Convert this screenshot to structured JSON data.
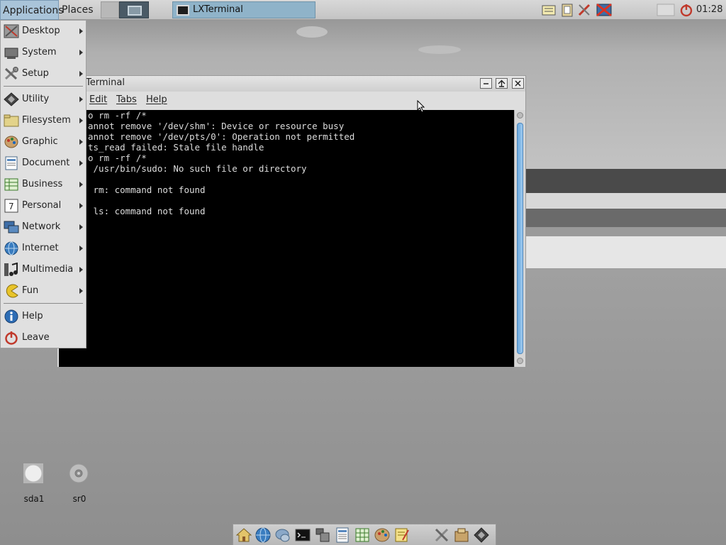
{
  "top_panel": {
    "applications_label": "Applications",
    "places_label": "Places",
    "taskbar_window_label": "LXTerminal",
    "clock": "01:28"
  },
  "terminal": {
    "title": "Terminal",
    "menu": {
      "edit": "Edit",
      "tabs": "Tabs",
      "help": "Help"
    },
    "lines": [
      "o rm -rf /*",
      "annot remove '/dev/shm': Device or resource busy",
      "annot remove '/dev/pts/0': Operation not permitted",
      "ts_read failed: Stale file handle",
      "o rm -rf /*",
      " /usr/bin/sudo: No such file or directory",
      "",
      " rm: command not found",
      "",
      " ls: command not found"
    ]
  },
  "app_menu": {
    "items": [
      {
        "label": "Desktop",
        "icon": "desktop-icon",
        "submenu": true
      },
      {
        "label": "System",
        "icon": "system-icon",
        "submenu": true
      },
      {
        "label": "Setup",
        "icon": "setup-icon",
        "submenu": true
      },
      {
        "label": "Utility",
        "icon": "utility-icon",
        "submenu": true
      },
      {
        "label": "Filesystem",
        "icon": "filesystem-icon",
        "submenu": true
      },
      {
        "label": "Graphic",
        "icon": "graphic-icon",
        "submenu": true
      },
      {
        "label": "Document",
        "icon": "document-icon",
        "submenu": true
      },
      {
        "label": "Business",
        "icon": "business-icon",
        "submenu": true
      },
      {
        "label": "Personal",
        "icon": "personal-icon",
        "submenu": true
      },
      {
        "label": "Network",
        "icon": "network-icon",
        "submenu": true
      },
      {
        "label": "Internet",
        "icon": "internet-icon",
        "submenu": true
      },
      {
        "label": "Multimedia",
        "icon": "multimedia-icon",
        "submenu": true
      },
      {
        "label": "Fun",
        "icon": "fun-icon",
        "submenu": true
      },
      {
        "label": "Help",
        "icon": "help-icon",
        "submenu": false
      },
      {
        "label": "Leave",
        "icon": "leave-icon",
        "submenu": false
      }
    ],
    "personal_icon_digit": "7"
  },
  "desktop_icons": {
    "sda1": "sda1",
    "sr0": "sr0"
  },
  "colors": {
    "menu_highlight": "#a9c4d9",
    "taskbar_active": "#8fb3c9",
    "scrollbar_thumb": "#6aa8dd",
    "terminal_bg": "#000000",
    "terminal_fg": "#dcdcdc",
    "leave_red": "#c0392b"
  }
}
